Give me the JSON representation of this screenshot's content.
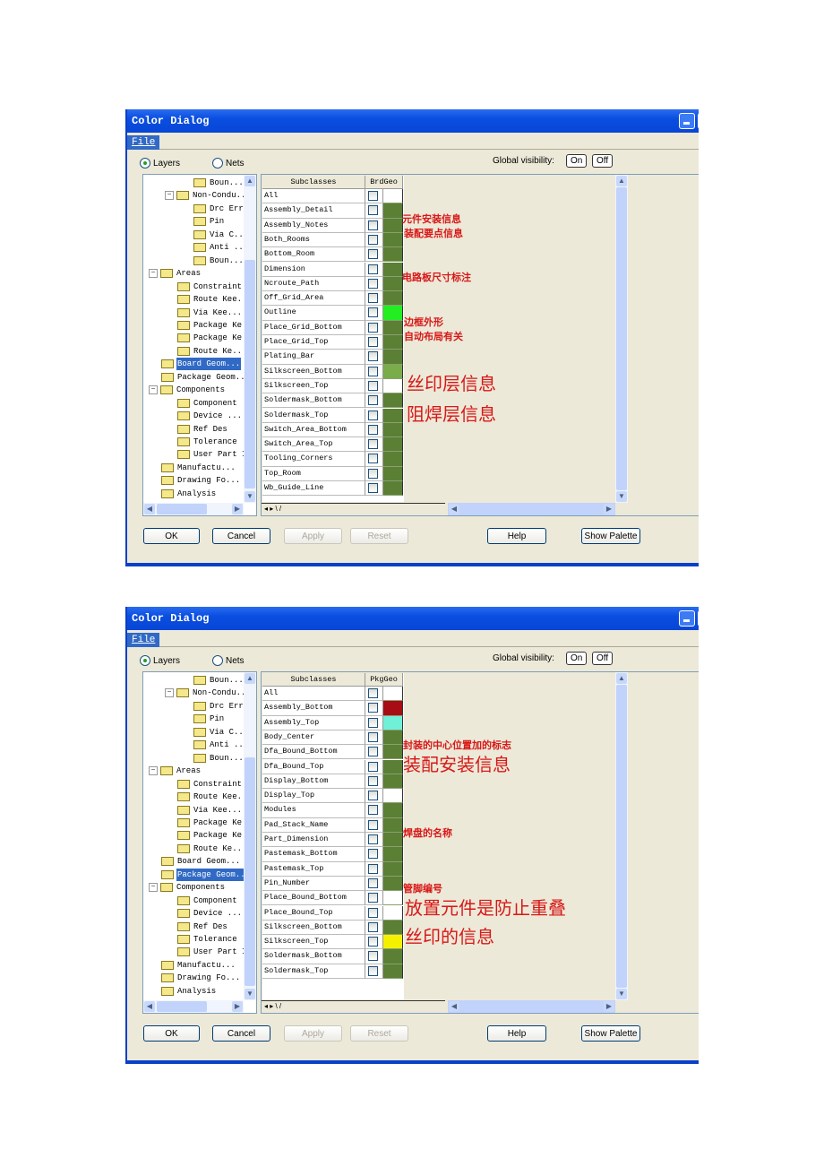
{
  "dialogs": [
    {
      "title": "Color Dialog",
      "menu": "File",
      "radio_layers": "Layers",
      "radio_nets": "Nets",
      "selected_radio": "Layers",
      "global_visibility": "Global visibility:",
      "on": "On",
      "off": "Off",
      "tree": [
        {
          "label": "Boun...",
          "depth": 3
        },
        {
          "label": "Non-Condu..",
          "depth": 2,
          "expanded": true
        },
        {
          "label": "Drc Err",
          "depth": 3
        },
        {
          "label": "Pin",
          "depth": 3
        },
        {
          "label": "Via C..",
          "depth": 3
        },
        {
          "label": "Anti ..",
          "depth": 3
        },
        {
          "label": "Boun...",
          "depth": 3
        },
        {
          "label": "Areas",
          "depth": 1,
          "expanded": true
        },
        {
          "label": "Constraint",
          "depth": 2
        },
        {
          "label": "Route Kee..",
          "depth": 2
        },
        {
          "label": "Via Kee...",
          "depth": 2
        },
        {
          "label": "Package Ke",
          "depth": 2
        },
        {
          "label": "Package Ke.",
          "depth": 2
        },
        {
          "label": "Route Ke...",
          "depth": 2
        },
        {
          "label": "Board Geom...",
          "depth": 1,
          "selected": true
        },
        {
          "label": "Package Geom..",
          "depth": 1
        },
        {
          "label": "Components",
          "depth": 1,
          "expanded": true
        },
        {
          "label": "Component '",
          "depth": 2
        },
        {
          "label": "Device ...",
          "depth": 2
        },
        {
          "label": "Ref Des",
          "depth": 2
        },
        {
          "label": "Tolerance",
          "depth": 2
        },
        {
          "label": "User Part I",
          "depth": 2
        },
        {
          "label": "Manufactu...",
          "depth": 1
        },
        {
          "label": "Drawing Fo...",
          "depth": 1
        },
        {
          "label": "Analysis",
          "depth": 1
        }
      ],
      "col_subclasses": "Subclasses",
      "col_class": "BrdGeo",
      "rows": [
        {
          "name": "All",
          "color": "#ffffff"
        },
        {
          "name": "Assembly_Detail",
          "color": "#5a7f35"
        },
        {
          "name": "Assembly_Notes",
          "color": "#5a7f35"
        },
        {
          "name": "Both_Rooms",
          "color": "#5a7f35"
        },
        {
          "name": "Bottom_Room",
          "color": "#5a7f35"
        },
        {
          "name": "Dimension",
          "color": "#5a7f35"
        },
        {
          "name": "Ncroute_Path",
          "color": "#5a7f35"
        },
        {
          "name": "Off_Grid_Area",
          "color": "#5a7f35"
        },
        {
          "name": "Outline",
          "color": "#22ee22"
        },
        {
          "name": "Place_Grid_Bottom",
          "color": "#5a7f35"
        },
        {
          "name": "Place_Grid_Top",
          "color": "#5a7f35"
        },
        {
          "name": "Plating_Bar",
          "color": "#5a7f35"
        },
        {
          "name": "Silkscreen_Bottom",
          "color": "#7aad4a"
        },
        {
          "name": "Silkscreen_Top",
          "color": "#ffffff"
        },
        {
          "name": "Soldermask_Bottom",
          "color": "#5a7f35"
        },
        {
          "name": "Soldermask_Top",
          "color": "#5a7f35"
        },
        {
          "name": "Switch_Area_Bottom",
          "color": "#5a7f35"
        },
        {
          "name": "Switch_Area_Top",
          "color": "#5a7f35"
        },
        {
          "name": "Tooling_Corners",
          "color": "#5a7f35"
        },
        {
          "name": "Top_Room",
          "color": "#5a7f35"
        },
        {
          "name": "Wb_Guide_Line",
          "color": "#5a7f35"
        }
      ],
      "buttons": {
        "ok": "OK",
        "cancel": "Cancel",
        "apply": "Apply",
        "reset": "Reset",
        "help": "Help",
        "show_palette": "Show Palette"
      },
      "annotations": [
        "元件安装信息",
        "装配要点信息",
        "电路板尺寸标注",
        "边框外形",
        "自动布局有关",
        "丝印层信息",
        "阻焊层信息"
      ]
    },
    {
      "title": "Color Dialog",
      "menu": "File",
      "radio_layers": "Layers",
      "radio_nets": "Nets",
      "selected_radio": "Layers",
      "global_visibility": "Global visibility:",
      "on": "On",
      "off": "Off",
      "tree": [
        {
          "label": "Boun...",
          "depth": 3
        },
        {
          "label": "Non-Condu..",
          "depth": 2,
          "expanded": true
        },
        {
          "label": "Drc Err",
          "depth": 3
        },
        {
          "label": "Pin",
          "depth": 3
        },
        {
          "label": "Via C..",
          "depth": 3
        },
        {
          "label": "Anti ..",
          "depth": 3
        },
        {
          "label": "Boun...",
          "depth": 3
        },
        {
          "label": "Areas",
          "depth": 1,
          "expanded": true
        },
        {
          "label": "Constraint",
          "depth": 2
        },
        {
          "label": "Route Kee..",
          "depth": 2
        },
        {
          "label": "Via Kee...",
          "depth": 2
        },
        {
          "label": "Package Ke",
          "depth": 2
        },
        {
          "label": "Package Ke.",
          "depth": 2
        },
        {
          "label": "Route Ke...",
          "depth": 2
        },
        {
          "label": "Board Geom...",
          "depth": 1
        },
        {
          "label": "Package Geom..",
          "depth": 1,
          "selected": true
        },
        {
          "label": "Components",
          "depth": 1,
          "expanded": true
        },
        {
          "label": "Component '",
          "depth": 2
        },
        {
          "label": "Device ...",
          "depth": 2
        },
        {
          "label": "Ref Des",
          "depth": 2
        },
        {
          "label": "Tolerance",
          "depth": 2
        },
        {
          "label": "User Part I",
          "depth": 2
        },
        {
          "label": "Manufactu...",
          "depth": 1
        },
        {
          "label": "Drawing Fo...",
          "depth": 1
        },
        {
          "label": "Analysis",
          "depth": 1
        }
      ],
      "col_subclasses": "Subclasses",
      "col_class": "PkgGeo",
      "rows": [
        {
          "name": "All",
          "color": "#ffffff"
        },
        {
          "name": "Assembly_Bottom",
          "color": "#a80c14"
        },
        {
          "name": "Assembly_Top",
          "color": "#70f0d8"
        },
        {
          "name": "Body_Center",
          "color": "#5a7f35"
        },
        {
          "name": "Dfa_Bound_Bottom",
          "color": "#5a7f35"
        },
        {
          "name": "Dfa_Bound_Top",
          "color": "#5a7f35"
        },
        {
          "name": "Display_Bottom",
          "color": "#5a7f35"
        },
        {
          "name": "Display_Top",
          "color": "#ffffff"
        },
        {
          "name": "Modules",
          "color": "#5a7f35"
        },
        {
          "name": "Pad_Stack_Name",
          "color": "#5a7f35"
        },
        {
          "name": "Part_Dimension",
          "color": "#5a7f35"
        },
        {
          "name": "Pastemask_Bottom",
          "color": "#5a7f35"
        },
        {
          "name": "Pastemask_Top",
          "color": "#5a7f35"
        },
        {
          "name": "Pin_Number",
          "color": "#5a7f35"
        },
        {
          "name": "Place_Bound_Bottom",
          "color": "#ffffff"
        },
        {
          "name": "Place_Bound_Top",
          "color": "#ffffff"
        },
        {
          "name": "Silkscreen_Bottom",
          "color": "#5a7f35"
        },
        {
          "name": "Silkscreen_Top",
          "color": "#f4f000"
        },
        {
          "name": "Soldermask_Bottom",
          "color": "#5a7f35"
        },
        {
          "name": "Soldermask_Top",
          "color": "#5a7f35"
        }
      ],
      "buttons": {
        "ok": "OK",
        "cancel": "Cancel",
        "apply": "Apply",
        "reset": "Reset",
        "help": "Help",
        "show_palette": "Show Palette"
      },
      "annotations": [
        "封装的中心位置加的标志",
        "装配安装信息",
        "焊盘的名称",
        "管脚编号",
        "放置元件是防止重叠",
        "丝印的信息"
      ]
    }
  ]
}
